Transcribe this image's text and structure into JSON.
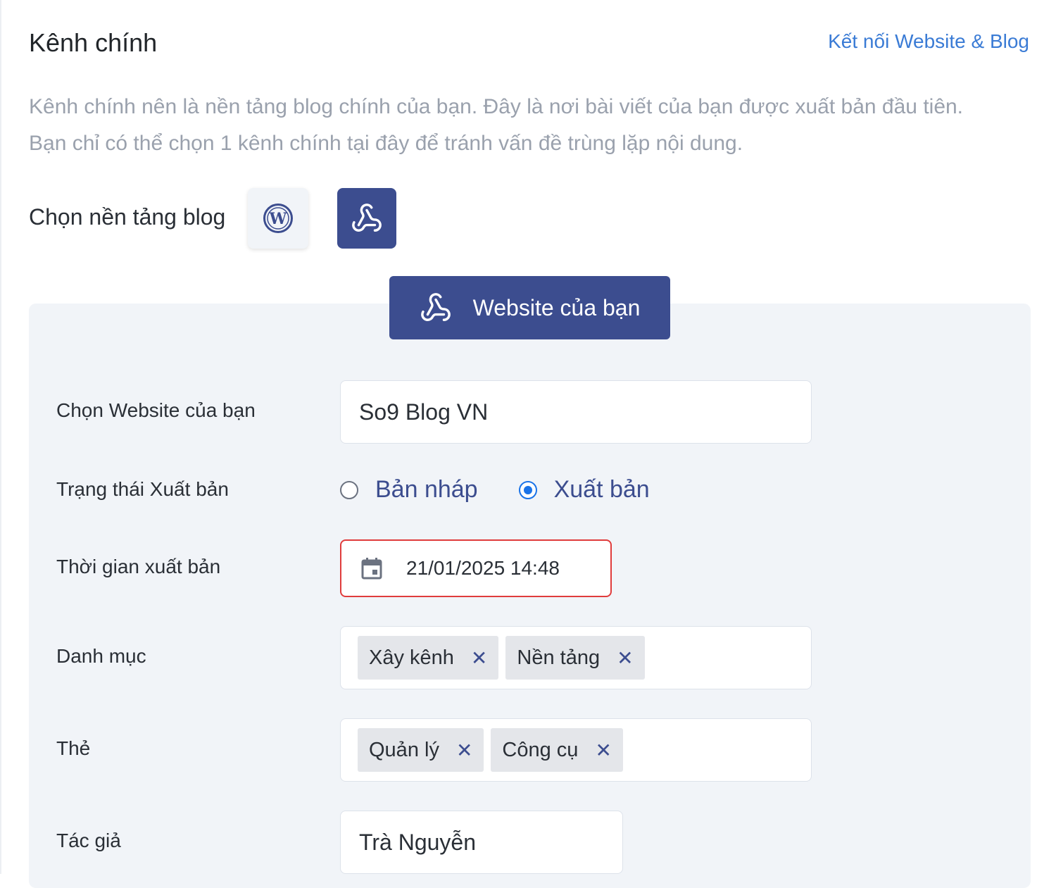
{
  "header": {
    "title": "Kênh chính",
    "connect_link": "Kết nối Website & Blog"
  },
  "description": {
    "line1": "Kênh chính nên là nền tảng blog chính của bạn. Đây là nơi bài viết của bạn được xuất bản đầu tiên.",
    "line2": "Bạn chỉ có thể chọn 1 kênh chính tại đây để tránh vấn đề trùng lặp nội dung."
  },
  "platform": {
    "label": "Chọn nền tảng blog",
    "options": [
      {
        "icon": "wordpress-icon",
        "selected": false
      },
      {
        "icon": "webhook-icon",
        "selected": true
      }
    ]
  },
  "website_tab": {
    "icon": "webhook-icon",
    "label": "Website của bạn"
  },
  "form": {
    "website": {
      "label": "Chọn Website của bạn",
      "value": "So9 Blog VN"
    },
    "status": {
      "label": "Trạng thái Xuất bản",
      "options": [
        {
          "label": "Bản nháp",
          "checked": false
        },
        {
          "label": "Xuất bản",
          "checked": true
        }
      ]
    },
    "publish_time": {
      "label": "Thời gian xuất bản",
      "value": "21/01/2025 14:48",
      "icon": "calendar-icon"
    },
    "category": {
      "label": "Danh mục",
      "tags": [
        "Xây kênh",
        "Nền tảng"
      ]
    },
    "tags": {
      "label": "Thẻ",
      "tags": [
        "Quản lý",
        "Công cụ"
      ]
    },
    "author": {
      "label": "Tác giả",
      "value": "Trà Nguyễn"
    }
  },
  "colors": {
    "primary": "#3c4d8f",
    "link": "#3a7bd5",
    "radio_checked": "#1a73e8",
    "error_border": "#e03c3c",
    "panel_bg": "#f1f4f8"
  },
  "chip_remove_symbol": "✕"
}
